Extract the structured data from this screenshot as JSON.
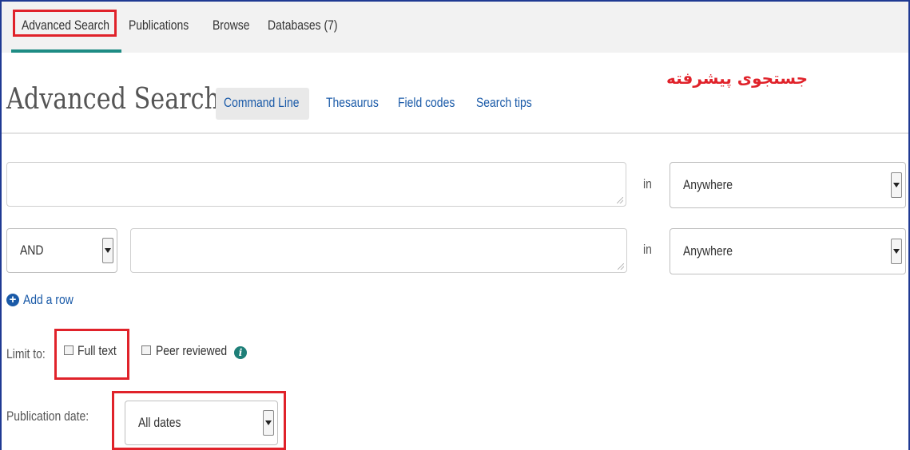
{
  "nav": {
    "tabs": [
      {
        "label": "Advanced Search",
        "active": true
      },
      {
        "label": "Publications"
      },
      {
        "label": "Browse"
      },
      {
        "label": "Databases (7)"
      }
    ]
  },
  "header": {
    "title": "Advanced Search",
    "links": [
      "Command Line",
      "Thesaurus",
      "Field codes",
      "Search tips"
    ],
    "annotation": "جستجوی پیشرفته"
  },
  "search_rows": [
    {
      "operator": null,
      "value": "",
      "in_label": "in",
      "field": "Anywhere"
    },
    {
      "operator": "AND",
      "value": "",
      "in_label": "in",
      "field": "Anywhere"
    }
  ],
  "add_row_label": "Add a row",
  "limit": {
    "label": "Limit to:",
    "full_text": {
      "label": "Full text",
      "checked": false
    },
    "peer_reviewed": {
      "label": "Peer reviewed",
      "checked": false
    }
  },
  "pub_date": {
    "label": "Publication date:",
    "value": "All dates"
  },
  "colors": {
    "accent": "#1e8c84",
    "link": "#1a5aa8",
    "highlight": "#e0222a"
  },
  "icons": [
    "plus-circle-icon",
    "info-icon",
    "dropdown-arrow-icon",
    "resize-grip-icon"
  ]
}
